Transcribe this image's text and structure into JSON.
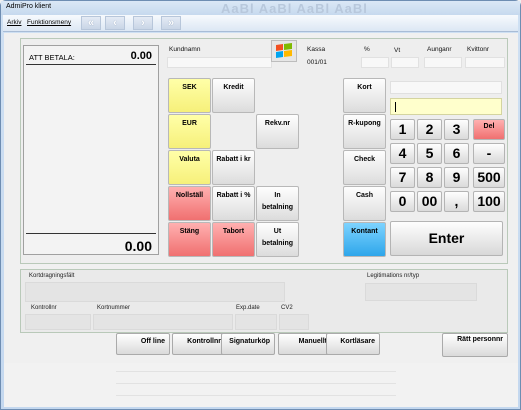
{
  "window": {
    "title": "AdmiPro klient",
    "title_bg_text": "AaBl AaBl AaBl AaBl"
  },
  "menu": {
    "items": [
      "Arkiv",
      "Funktionsmeny"
    ]
  },
  "payment": {
    "label": "ATT BETALA:",
    "amount": "0.00",
    "total": "0.00"
  },
  "header": {
    "kundnamn": "Kundnamn",
    "kassa": "Kassa",
    "kassa_value": "001/01",
    "percent": "%",
    "vat": "Vt",
    "aunganr": "Aunganr",
    "kvittonr": "Kvittonr"
  },
  "buttons": {
    "sek": "SEK",
    "kredit": "Kredit",
    "eur": "EUR",
    "rekvnr": "Rekv.nr",
    "valuta": "Valuta",
    "rabatt_kr": "Rabatt i kr",
    "nollstall": "Nollställ",
    "rabatt_pct": "Rabatt i %",
    "in_betalning": "In betalning",
    "stang": "Stäng",
    "tabort": "Tabort",
    "ut_betalning": "Ut betalning",
    "kort": "Kort",
    "rkupong": "R-kupong",
    "check": "Check",
    "cash": "Cash",
    "kontant": "Kontant"
  },
  "keypad": {
    "row1": [
      "1",
      "2",
      "3",
      "Del"
    ],
    "row2": [
      "4",
      "5",
      "6",
      "-"
    ],
    "row3": [
      "7",
      "8",
      "9",
      "500"
    ],
    "row4": [
      "0",
      "00",
      ",",
      "100"
    ],
    "enter": "Enter"
  },
  "card": {
    "kortdragning": "Kortdragningsfält",
    "legitimation": "Legitimations nr/typ",
    "kontrollnr": "Kontrollnr",
    "kortnummer": "Kortnummer",
    "expdate": "Exp.date",
    "cv2": "CV2"
  },
  "bottom": {
    "offline": "Off line",
    "kontrollnr": "Kontrollnr",
    "signaturkop": "Signaturköp",
    "manuellt": "Manuellt",
    "kortlasare": "Kortläsare",
    "ratt_personnr": "Rätt personnr"
  },
  "colors": {
    "yellow": "#f6f07a",
    "red": "#f07070",
    "blue": "#2ea6ea"
  }
}
